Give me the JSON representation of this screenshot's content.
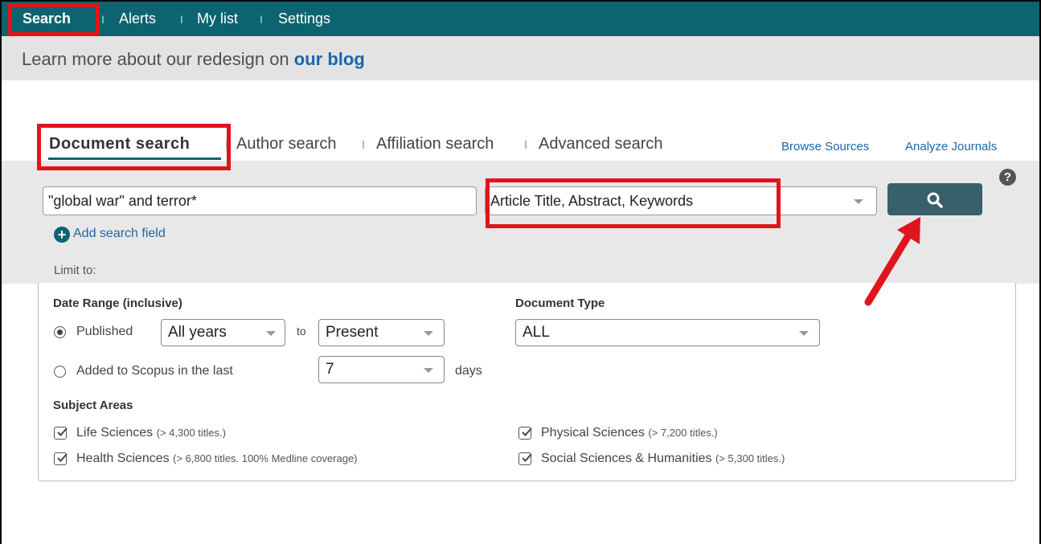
{
  "topnav": {
    "items": [
      {
        "label": "Search"
      },
      {
        "label": "Alerts"
      },
      {
        "label": "My list"
      },
      {
        "label": "Settings"
      }
    ],
    "separator": "I"
  },
  "banner": {
    "text": "Learn more about our redesign on ",
    "link": "our blog"
  },
  "tabs": [
    {
      "label": "Document search"
    },
    {
      "label": "Author search"
    },
    {
      "label": "Affiliation search"
    },
    {
      "label": "Advanced search"
    }
  ],
  "links": {
    "browse_sources": "Browse Sources",
    "analyze_journals": "Analyze Journals"
  },
  "help_icon": "?",
  "search": {
    "query": "\"global war\" and terror*",
    "field": "Article Title, Abstract, Keywords",
    "add_field": "Add search field",
    "search_icon": "search-icon"
  },
  "limit_to": "Limit to:",
  "date_range": {
    "heading": "Date Range (inclusive)",
    "published_label": "Published",
    "from": "All years",
    "to_label": "to",
    "to": "Present",
    "added_label": "Added to Scopus in the last",
    "days_value": "7",
    "days_label": "days"
  },
  "document_type": {
    "heading": "Document Type",
    "value": "ALL"
  },
  "subject_areas": {
    "heading": "Subject Areas",
    "items": [
      {
        "label": "Life Sciences",
        "note": "(> 4,300 titles.)",
        "checked": true
      },
      {
        "label": "Health Sciences",
        "note": "(> 6,800 titles. 100% Medline coverage)",
        "checked": true
      },
      {
        "label": "Physical Sciences",
        "note": "(> 7,200 titles.)",
        "checked": true
      },
      {
        "label": "Social Sciences & Humanities",
        "note": "(> 5,300 titles.)",
        "checked": true
      }
    ]
  },
  "colors": {
    "nav": "#0c6470",
    "link": "#1a67a8",
    "button": "#37606a",
    "annotation": "#e0141c"
  }
}
